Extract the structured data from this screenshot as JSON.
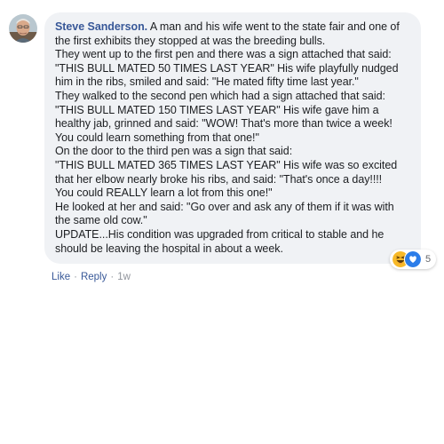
{
  "comment": {
    "author": "Steve Sanderson.",
    "first_line_text": " A man and his wife went to the state fair and one of",
    "lines": [
      "the first exhibits they stopped at was the breeding bulls.",
      "They went up to the first pen and there was a sign attached that said:",
      "\"THIS BULL MATED 50 TIMES LAST YEAR\" His wife playfully nudged",
      "him in the ribs, smiled and said: \"He mated fifty time last year.\"",
      "They walked to the second pen which had a sign attached that said:",
      "\"THIS BULL MATED 150 TIMES LAST YEAR\" His wife gave him a",
      "healthy jab, grinned and said: \"WOW! That's more than twice a week!",
      "You could learn something from that one!\"",
      "On the door to the third pen was a sign that said:",
      "\"THIS BULL MATED 365 TIMES LAST YEAR\" His wife was so excited",
      "that her elbow nearly broke his ribs, and said: \"That's once a day!!!!",
      "You could REALLY learn a lot from this one!\"",
      "He looked at her and said: \"Go over and ask any of them if it was with",
      "the same old cow.\"",
      "UPDATE...His condition was upgraded from critical to stable and he",
      "should be leaving the hospital in about a week."
    ]
  },
  "reactions": {
    "count": "5",
    "icons": [
      "haha-icon",
      "love-icon"
    ]
  },
  "actions": {
    "like": "Like",
    "separator": "·",
    "reply": "Reply",
    "time": "1w"
  }
}
